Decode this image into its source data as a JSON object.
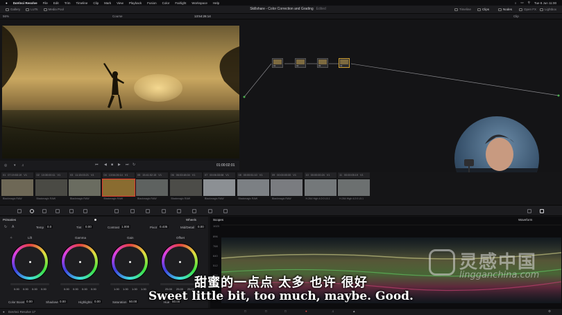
{
  "menubar": {
    "app": "DaVinci Resolve",
    "items": [
      "File",
      "Edit",
      "Trim",
      "Timeline",
      "Clip",
      "Mark",
      "View",
      "Playback",
      "Fusion",
      "Color",
      "Fairlight",
      "Workspace",
      "Help"
    ],
    "clock": "Tue 8 Jun 11:00"
  },
  "toolbar": {
    "gallery": "Gallery",
    "luts": "LUTs",
    "media_pool": "Media Pool",
    "project_title": "Skillshare - Color Correction and Grading",
    "edited": "Edited",
    "timeline": "Timeline",
    "clips": "Clips",
    "nodes": "Nodes",
    "open_fx": "Open FX",
    "lightbox": "Lightbox"
  },
  "subbar": {
    "zoom": "56%",
    "timeline_name": "Course",
    "timecode": "13:54:26:14",
    "clip_mode": "Clip"
  },
  "viewer": {
    "timecode": "01:00:02:01"
  },
  "clips": [
    {
      "num": "01",
      "tc": "07:19:53:19",
      "track": "V1",
      "name": "Blackmagic RAW",
      "thumb": "#6e6856"
    },
    {
      "num": "02",
      "tc": "10:30:00:11",
      "track": "V1",
      "name": "Blackmagic RAW",
      "thumb": "#4a4a44"
    },
    {
      "num": "03",
      "tc": "11:15:03:21",
      "track": "V1",
      "name": "Blackmagic RAW",
      "thumb": "#6a6c60"
    },
    {
      "num": "04",
      "tc": "13:54:26:14",
      "track": "V1",
      "name": "Blackmagic RAW",
      "thumb": "#8a6c30"
    },
    {
      "num": "05",
      "tc": "15:41:52:15",
      "track": "V1",
      "name": "Blackmagic RAW",
      "thumb": "#5e6260"
    },
    {
      "num": "06",
      "tc": "06:03:48:04",
      "track": "V1",
      "name": "Blackmagic RAW",
      "thumb": "#4c4c48"
    },
    {
      "num": "07",
      "tc": "00:06:33:08",
      "track": "V1",
      "name": "Blackmagic RAW",
      "thumb": "#8c9094"
    },
    {
      "num": "08",
      "tc": "00:00:51:10",
      "track": "V1",
      "name": "Blackmagic RAW",
      "thumb": "#7c8084"
    },
    {
      "num": "09",
      "tc": "00:00:00:00",
      "track": "V1",
      "name": "Blackmagic RAW",
      "thumb": "#7a7c80"
    },
    {
      "num": "10",
      "tc": "00:00:00:24",
      "track": "V1",
      "name": "H.264 High 4:2:0 L5.1",
      "thumb": "#74787a"
    },
    {
      "num": "11",
      "tc": "00:00:05:19",
      "track": "V1",
      "name": "H.264 High 4:2:0 L5.1",
      "thumb": "#6c7070"
    }
  ],
  "nodes": [
    "01",
    "02",
    "03",
    "04"
  ],
  "primaries": {
    "title": "Primaries",
    "mode": "Wheels",
    "temp_label": "Temp",
    "temp": "0.0",
    "tint_label": "Tint",
    "tint": "0.00",
    "contrast_label": "Contrast",
    "contrast": "1.000",
    "pivot_label": "Pivot",
    "pivot": "0.435",
    "middetail_label": "Mid/Detail",
    "middetail": "0.00",
    "wheels": [
      {
        "name": "Lift",
        "vals": [
          "0.00",
          "0.00",
          "0.00",
          "0.00"
        ]
      },
      {
        "name": "Gamma",
        "vals": [
          "0.00",
          "0.00",
          "0.00",
          "0.00"
        ]
      },
      {
        "name": "Gain",
        "vals": [
          "1.00",
          "1.00",
          "1.00",
          "1.00"
        ]
      },
      {
        "name": "Offset",
        "vals": [
          "25.00",
          "25.00",
          "25.00"
        ]
      }
    ],
    "color_boost_label": "Color Boost",
    "color_boost": "0.00",
    "shadows_label": "Shadows",
    "shadows": "0.00",
    "highlights_label": "Highlights",
    "highlights": "0.00",
    "saturation_label": "Saturation",
    "saturation": "50.00",
    "hue_label": "Hue",
    "hue": "50.00"
  },
  "scopes": {
    "title": "Scopes",
    "mode": "Waveform",
    "levels": [
      "1023",
      "896",
      "768",
      "640",
      "512",
      "384",
      "256",
      "128"
    ]
  },
  "status": {
    "app": "DaVinci Resolve 17"
  },
  "subtitle": {
    "chinese": "甜蜜的一点点 太多 也许 很好",
    "english": "Sweet little bit, too much, maybe. Good."
  },
  "watermark": {
    "cn": "灵感中国",
    "en": "lingganchina.com"
  }
}
